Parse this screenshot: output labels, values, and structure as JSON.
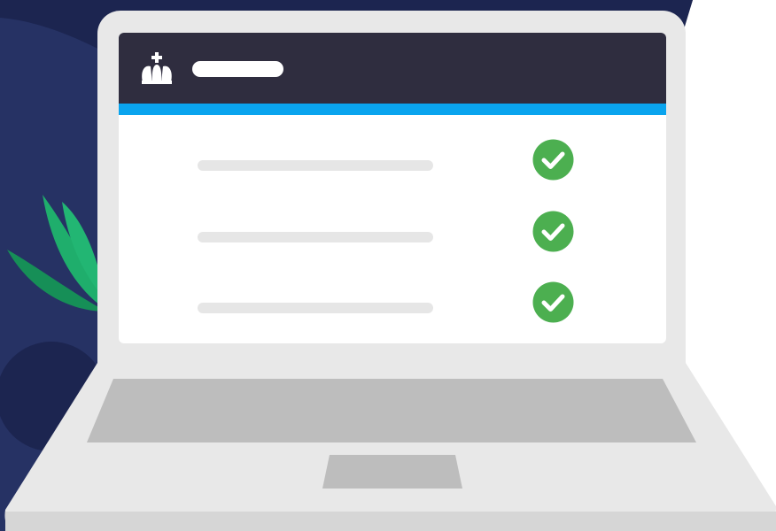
{
  "colors": {
    "navy": "#263264",
    "dark_navy": "#1c2550",
    "leaf_green": "#1fae6c",
    "leaf_dark": "#168f57",
    "laptop_body": "#e8e8e8",
    "keyboard": "#bdbdbd",
    "header_dark": "#2f2d3f",
    "accent_blue": "#0aa4ee",
    "check_green": "#4caf50"
  },
  "header": {
    "logo_icon": "crown-logo-icon"
  },
  "checklist": {
    "items": [
      {
        "status": "checked",
        "icon": "check-circle-icon"
      },
      {
        "status": "checked",
        "icon": "check-circle-icon"
      },
      {
        "status": "checked",
        "icon": "check-circle-icon"
      }
    ]
  }
}
